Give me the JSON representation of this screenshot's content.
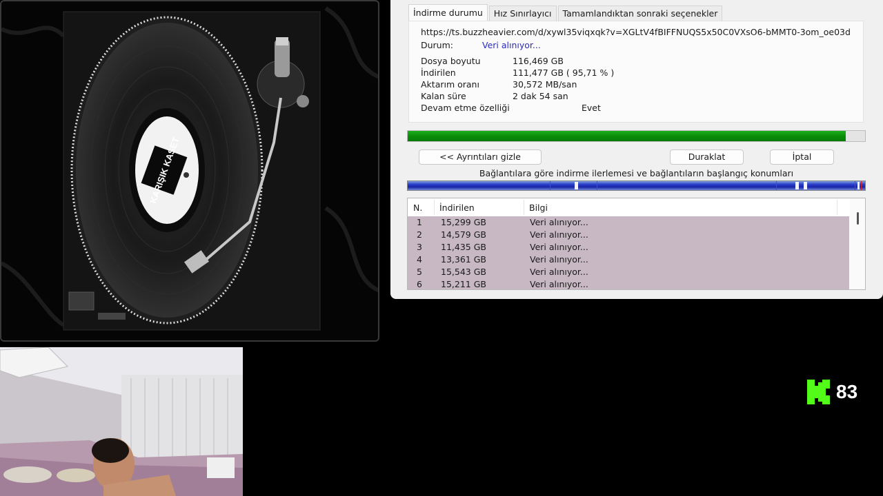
{
  "dialog": {
    "tabs": [
      "İndirme durumu",
      "Hız Sınırlayıcı",
      "Tamamlandıktan sonraki seçenekler"
    ],
    "url": "https://ts.buzzheavier.com/d/xywl35viqxqk?v=XGLtV4fBIFFNUQS5x50C0VXsO6-bMMT0-3om_oe03d",
    "status_label": "Durum:",
    "status_value": "Veri alınıyor...",
    "file_size_label": "Dosya boyutu",
    "file_size_value": "116,469  GB",
    "downloaded_label": "İndirilen",
    "downloaded_value": "111,477  GB  ( 95,71 % )",
    "transfer_rate_label": "Aktarım oranı",
    "transfer_rate_value": "30,572  MB/san",
    "time_left_label": "Kalan süre",
    "time_left_value": "2 dak 54 san",
    "resume_label": "Devam etme özelliği",
    "resume_value": "Evet",
    "progress_fraction": 0.9571,
    "hide_details_label": "<< Ayrıntıları gizle",
    "pause_label": "Duraklat",
    "cancel_label": "İptal",
    "connections_caption": "Bağlantılara göre indirme ilerlemesi ve bağlantıların başlangıç konumları",
    "table": {
      "headers": [
        "N.",
        "İndirilen",
        "Bilgi"
      ],
      "rows": [
        {
          "n": "1",
          "downloaded": "15,299  GB",
          "info": "Veri alınıyor..."
        },
        {
          "n": "2",
          "downloaded": "14,579  GB",
          "info": "Veri alınıyor..."
        },
        {
          "n": "3",
          "downloaded": "11,435  GB",
          "info": "Veri alınıyor..."
        },
        {
          "n": "4",
          "downloaded": "13,361  GB",
          "info": "Veri alınıyor..."
        },
        {
          "n": "5",
          "downloaded": "15,543  GB",
          "info": "Veri alınıyor..."
        },
        {
          "n": "6",
          "downloaded": "15,211  GB",
          "info": "Veri alınıyor..."
        }
      ]
    }
  },
  "turntable": {
    "label_text": "KARIŞIK KASET"
  },
  "kick": {
    "count": "83",
    "brand_color": "#53fc18"
  },
  "colors": {
    "progress_green": "#0b8f0b",
    "status_blue": "#2a2ac0",
    "table_row_bg": "#c7b8c4",
    "connection_bar_blue": "#1a25a8"
  }
}
